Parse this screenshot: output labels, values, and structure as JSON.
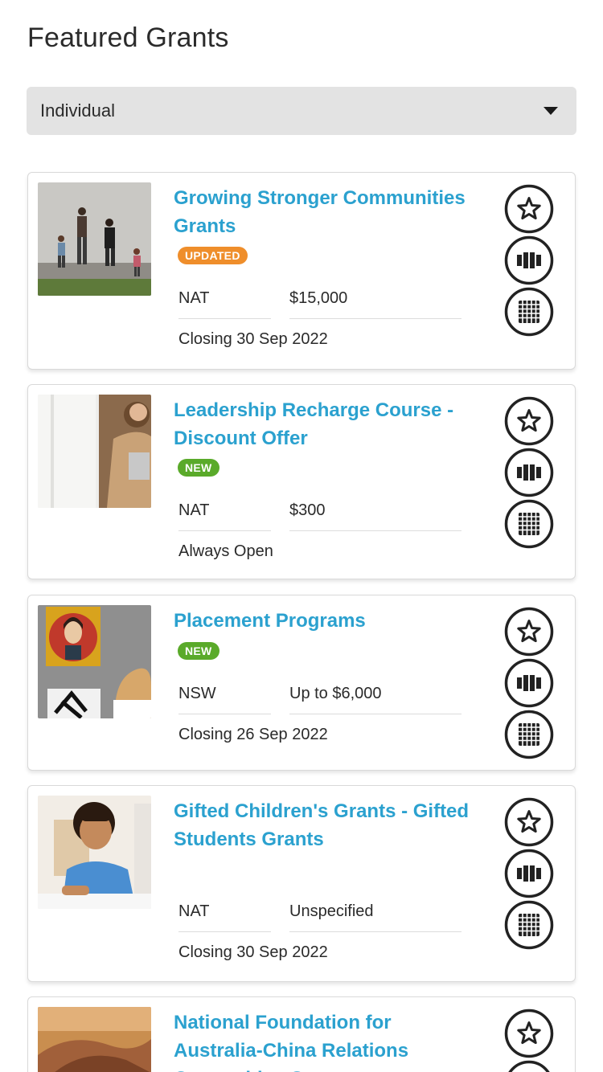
{
  "header": {
    "title": "Featured Grants"
  },
  "filter": {
    "selected": "Individual"
  },
  "colors": {
    "title_link": "#2ba1cf",
    "badge_updated": "#ef8e2b",
    "badge_new": "#5aaa2a"
  },
  "grants": [
    {
      "title": "Growing Stronger Communities Grants",
      "badge": "UPDATED",
      "location": "NAT",
      "amount": "$15,000",
      "closing": "Closing 30 Sep 2022",
      "image": "family-walking-photo"
    },
    {
      "title": "Leadership Recharge Course - Discount Offer",
      "badge": "NEW",
      "location": "NAT",
      "amount": "$300",
      "closing": "Always Open",
      "image": "woman-with-laptop-photo"
    },
    {
      "title": "Placement Programs",
      "badge": "NEW",
      "location": "NSW",
      "amount": "Up to $6,000",
      "closing": "Closing 26 Sep 2022",
      "image": "art-gallery-photo"
    },
    {
      "title": "Gifted Children's Grants - Gifted Students Grants",
      "badge": "",
      "location": "NAT",
      "amount": "Unspecified",
      "closing": "Closing 30 Sep 2022",
      "image": "boy-writing-photo"
    },
    {
      "title": "National Foundation for Australia-China Relations Competitive Grants",
      "image": "hands-photo"
    }
  ],
  "actions": {
    "favorite_icon": "star-icon",
    "compare_icon": "compare-icon",
    "calendar_icon": "calendar-grid-icon"
  }
}
